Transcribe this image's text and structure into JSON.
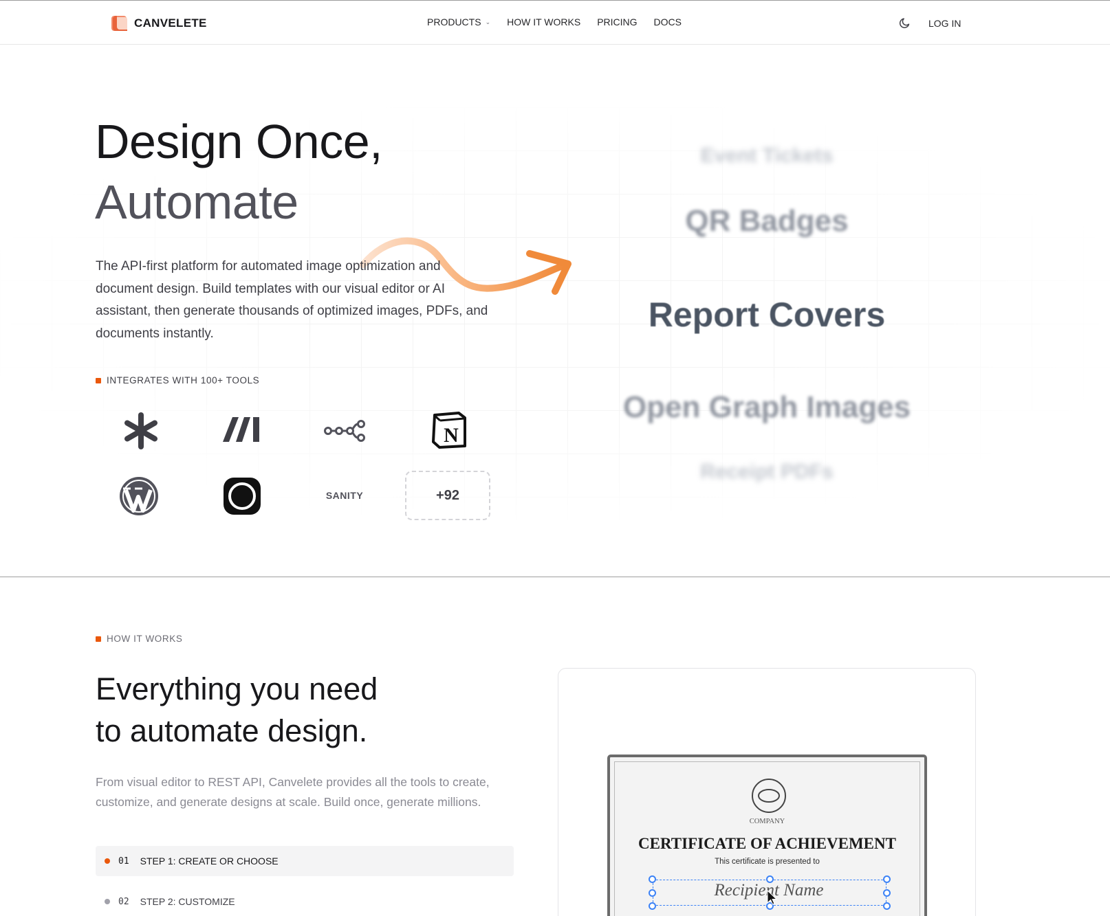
{
  "header": {
    "brand": "CANVELETE",
    "nav": {
      "products": "PRODUCTS",
      "how_it_works": "HOW IT WORKS",
      "pricing": "PRICING",
      "docs": "DOCS"
    },
    "login": "LOG IN"
  },
  "hero": {
    "title_line1": "Design Once,",
    "title_line2": "Automate",
    "description": "The API-first platform for automated image optimization and document design. Build templates with our visual editor or AI assistant, then generate thousands of optimized images, PDFs, and documents instantly.",
    "integrations_label": "INTEGRATES WITH 100+ TOOLS",
    "integrations": [
      {
        "icon": "asterisk-icon"
      },
      {
        "icon": "make-icon"
      },
      {
        "icon": "n8n-icon"
      },
      {
        "icon": "notion-icon"
      },
      {
        "icon": "wordpress-icon"
      },
      {
        "icon": "circle-app-icon"
      },
      {
        "label": "SANITY"
      },
      {
        "label": "+92"
      }
    ],
    "rotating_words": [
      "Event Tickets",
      "QR Badges",
      "Report Covers",
      "Open Graph Images",
      "Receipt PDFs"
    ]
  },
  "how_it_works": {
    "label": "HOW IT WORKS",
    "title_line1": "Everything you need",
    "title_line2": "to automate design.",
    "description": "From visual editor to REST API, Canvelete provides all the tools to create, customize, and generate designs at scale. Build once, generate millions.",
    "steps": [
      {
        "num": "01",
        "label": "STEP 1: CREATE OR CHOOSE",
        "active": true
      },
      {
        "num": "02",
        "label": "STEP 2: CUSTOMIZE",
        "active": false
      }
    ],
    "certificate": {
      "company": "COMPANY",
      "title": "CERTIFICATE OF ACHIEVEMENT",
      "presented": "This certificate is presented to",
      "recipient": "Recipient Name"
    }
  },
  "colors": {
    "accent": "#ea580c",
    "selection": "#3b82f6"
  }
}
